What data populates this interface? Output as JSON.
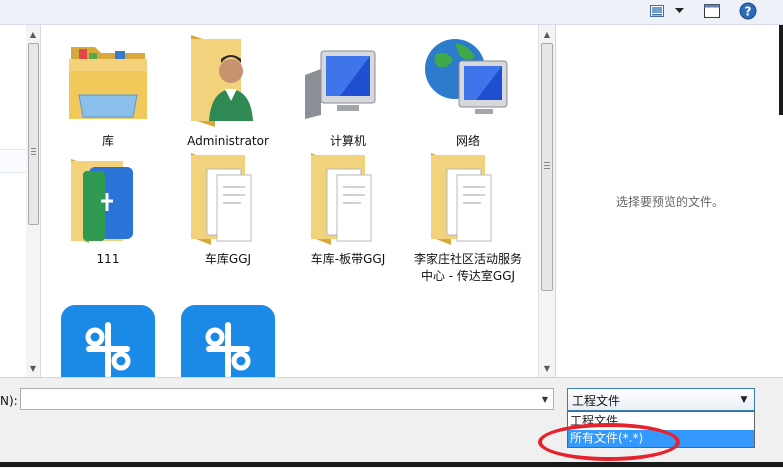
{
  "file_items": [
    {
      "label": "库",
      "icon": "library-folder-icon"
    },
    {
      "label": "Administrator",
      "icon": "user-folder-icon"
    },
    {
      "label": "计算机",
      "icon": "computer-icon"
    },
    {
      "label": "网络",
      "icon": "network-globe-icon"
    },
    {
      "label": "111",
      "icon": "app-folder-icon"
    },
    {
      "label": "车库GGJ",
      "icon": "document-folder-icon"
    },
    {
      "label": "车库-板带GGJ",
      "icon": "document-folder-icon"
    },
    {
      "label": "李家庄社区活动服务中心 - 传达室GGJ",
      "icon": "document-folder-icon"
    },
    {
      "label": "",
      "icon": "app-shortcut-icon"
    },
    {
      "label": "",
      "icon": "app-shortcut-icon"
    }
  ],
  "preview": {
    "message": "选择要预览的文件。"
  },
  "filename": {
    "label": "N):",
    "value": ""
  },
  "filetype": {
    "selected": "工程文件",
    "options": [
      "工程文件",
      "所有文件(*.*)"
    ],
    "highlighted_index": 1
  },
  "colors": {
    "accent": "#3399ff",
    "annotation": "#e8222c",
    "folder": "#f0c95a"
  }
}
